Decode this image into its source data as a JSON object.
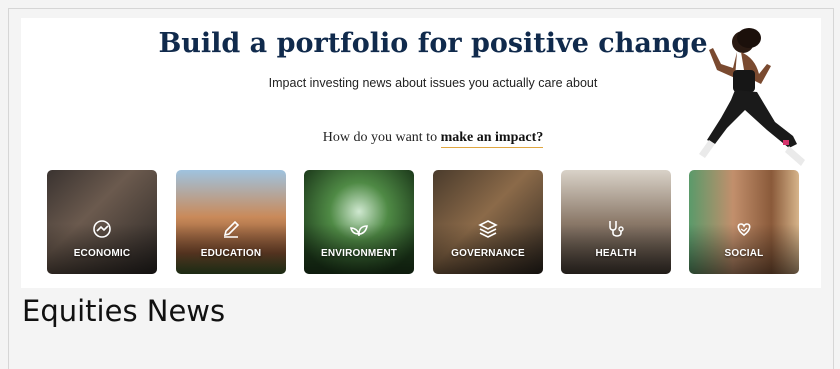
{
  "banner": {
    "headline": "Build a portfolio for positive change",
    "subline": "Impact investing news about issues you actually care about",
    "question_prefix": "How do you want to",
    "question_link": "make an impact?",
    "categories": [
      {
        "label": "ECONOMIC",
        "icon": "economic-icon"
      },
      {
        "label": "EDUCATION",
        "icon": "pencil-icon"
      },
      {
        "label": "ENVIRONMENT",
        "icon": "leaf-icon"
      },
      {
        "label": "GOVERNANCE",
        "icon": "layers-icon"
      },
      {
        "label": "HEALTH",
        "icon": "stethoscope-icon"
      },
      {
        "label": "SOCIAL",
        "icon": "heart-hand-icon"
      }
    ]
  },
  "section": {
    "title": "Equities News"
  },
  "colors": {
    "headline": "#102a4c",
    "link_underline": "#e0a640",
    "page_bg": "#f4f4f4"
  }
}
